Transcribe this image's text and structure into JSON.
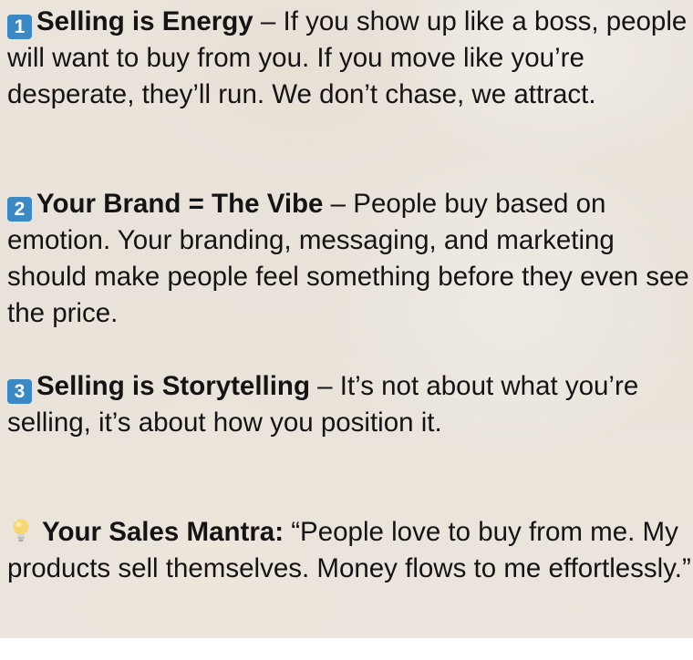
{
  "points": [
    {
      "badge": "1",
      "heading": "Selling is Energy",
      "text": " – If you show up like a boss, people will want to buy from you. If you move like you’re desperate, they’ll run. We don’t chase, we attract."
    },
    {
      "badge": "2",
      "heading": "Your Brand = The Vibe",
      "text": " – People buy based on emotion. Your branding, messaging, and marketing should make people feel something before they even see the price."
    },
    {
      "badge": "3",
      "heading": "Selling is Storytelling",
      "text": " – It’s not about what you’re selling, it’s about how you position it."
    }
  ],
  "mantra": {
    "icon": "light-bulb-icon",
    "heading": "Your Sales Mantra:",
    "text": " “People love to buy from me. My products sell themselves. Money flows to me effortlessly.”"
  },
  "colors": {
    "badge": "#3b88c3",
    "text": "#141414"
  }
}
